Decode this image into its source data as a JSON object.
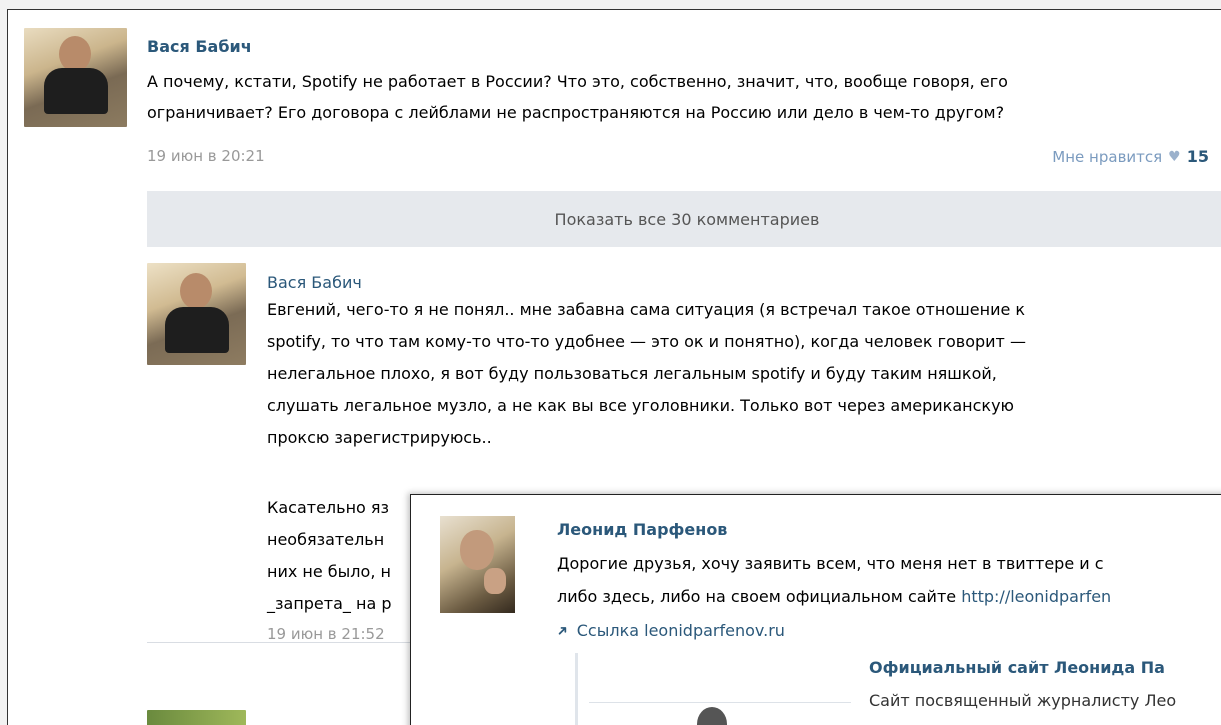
{
  "post": {
    "author": "Вася Бабич",
    "text_lines": [
      "А почему, кстати, Spotify не работает в России? Что это, собственно, значит, что, вообще говоря, его",
      "ограничивает? Его договора с лейблами не распространяются на Россию или дело в чем-то другом?"
    ],
    "date": "19 июн в 20:21",
    "like_label": "Мне нравится",
    "like_count": "15"
  },
  "show_all_label": "Показать все 30 комментариев",
  "comment": {
    "author": "Вася Бабич",
    "lines": [
      "Евгений, чего-то я не понял.. мне забавна сама ситуация (я встречал такое отношение к",
      "spotify, то что там кому-то что-то удобнее — это ок и понятно), когда человек говорит —",
      "нелегальное плохо, я вот буду пользоваться легальным spotify и буду таким няшкой,",
      "слушать легальное музло, а не как вы все уголовники. Только вот через американскую",
      "проксю зарегистрируюсь.."
    ],
    "lines2": [
      "Касательно яз",
      "необязательн",
      "них не было, н",
      "_запрета_ на р"
    ],
    "date": "19 июн в 21:52"
  },
  "popup": {
    "author": "Леонид Парфенов",
    "line1": "Дорогие друзья, хочу заявить всем, что меня нет в твиттере и с",
    "line2_text": "либо здесь, либо на своем официальном сайте ",
    "line2_link": "http://leonidparfen",
    "link_label": "Ссылка leonidparfenov.ru",
    "site_title": "Официальный сайт Леонида Па",
    "site_desc": "Сайт посвященный журналисту Лео"
  },
  "icons": {
    "heart": "heart-icon",
    "link_arrow": "link-arrow-icon"
  },
  "colors": {
    "link": "#2b587a",
    "meta": "#999999",
    "show_all_bg": "#e6e9ed"
  }
}
